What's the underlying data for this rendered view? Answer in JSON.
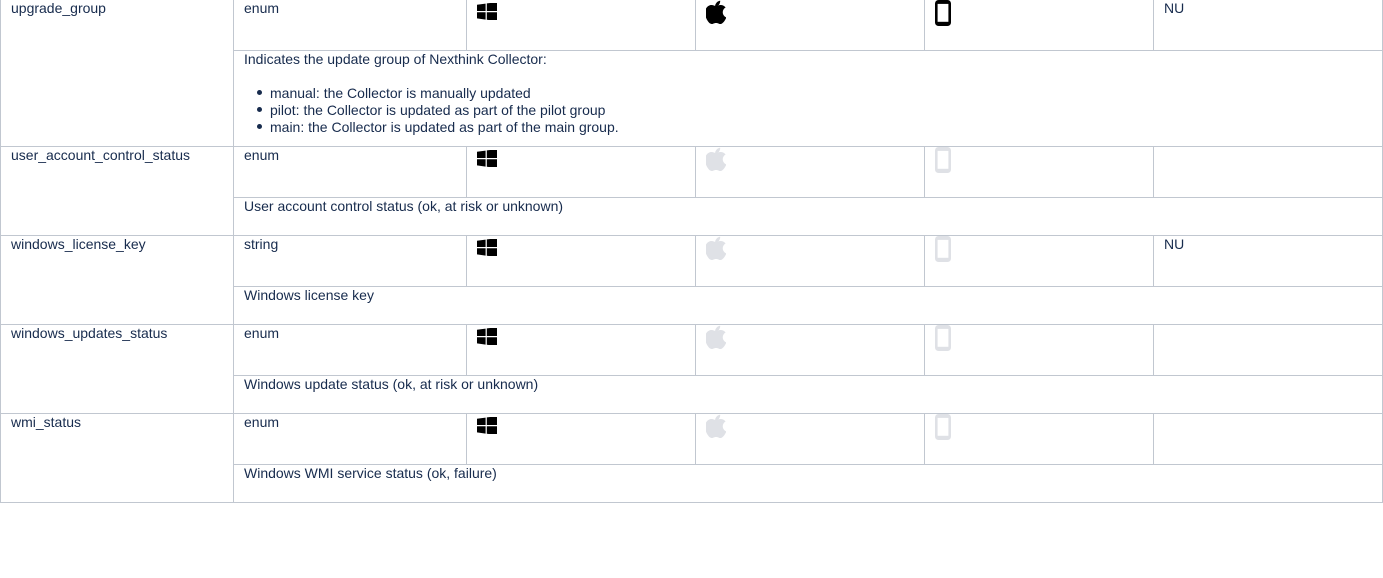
{
  "rows": [
    {
      "name": "upgrade_group",
      "type": "enum",
      "windows": true,
      "mac": true,
      "mobile": true,
      "extra": "NU",
      "description": "Indicates the update group of Nexthink Collector:",
      "bullets": [
        "manual: the Collector is manually updated",
        "pilot: the Collector is updated as part of the pilot group",
        "main: the Collector is updated as part of the main group."
      ]
    },
    {
      "name": "user_account_control_status",
      "type": "enum",
      "windows": true,
      "mac": false,
      "mobile": false,
      "extra": "",
      "description": "User account control status (ok, at risk or unknown)"
    },
    {
      "name": "windows_license_key",
      "type": "string",
      "windows": true,
      "mac": false,
      "mobile": false,
      "extra": "NU",
      "description": "Windows license key"
    },
    {
      "name": "windows_updates_status",
      "type": "enum",
      "windows": true,
      "mac": false,
      "mobile": false,
      "extra": "",
      "description": "Windows update status (ok, at risk or unknown)"
    },
    {
      "name": "wmi_status",
      "type": "enum",
      "windows": true,
      "mac": false,
      "mobile": false,
      "extra": "",
      "description": "Windows WMI service status (ok, failure)"
    }
  ],
  "icons": {
    "windows": "windows-icon",
    "mac": "apple-icon",
    "mobile": "mobile-phone-icon"
  },
  "colors": {
    "border": "#c1c7d0",
    "text": "#172b4d",
    "icon_active": "#000000",
    "icon_inactive": "#dfe1e6"
  }
}
